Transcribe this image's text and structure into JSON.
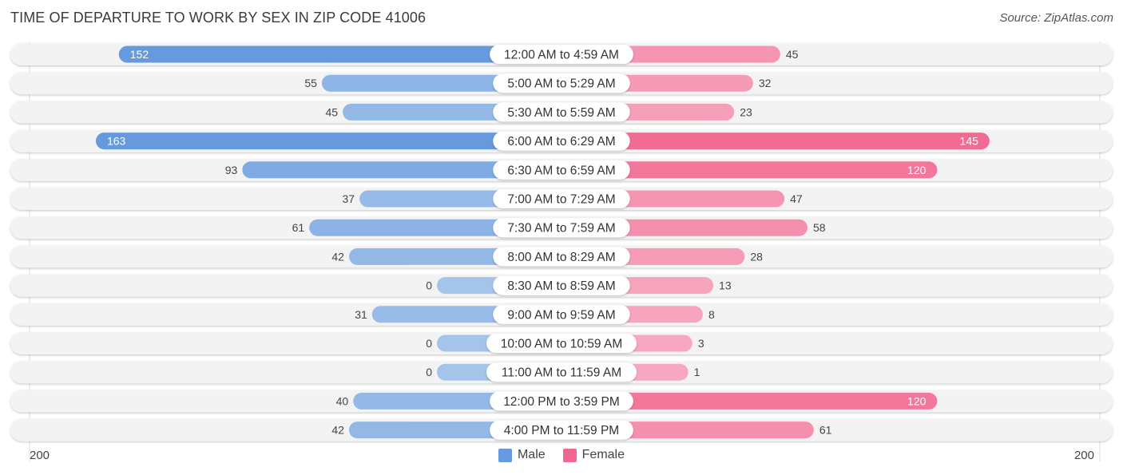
{
  "header": {
    "title": "TIME OF DEPARTURE TO WORK BY SEX IN ZIP CODE 41006",
    "source": "Source: ZipAtlas.com"
  },
  "colors": {
    "male_strong": "#6699dd",
    "male_light": "#a4c4ea",
    "female_strong": "#f06890",
    "female_light": "#f7a8c0",
    "row_bg": "#f3f3f3"
  },
  "legend": {
    "male_label": "Male",
    "female_label": "Female"
  },
  "axis": {
    "left_label": "200",
    "right_label": "200"
  },
  "chart_data": {
    "type": "bar",
    "orientation": "horizontal-diverging",
    "title": "TIME OF DEPARTURE TO WORK BY SEX IN ZIP CODE 41006",
    "categories": [
      "12:00 AM to 4:59 AM",
      "5:00 AM to 5:29 AM",
      "5:30 AM to 5:59 AM",
      "6:00 AM to 6:29 AM",
      "6:30 AM to 6:59 AM",
      "7:00 AM to 7:29 AM",
      "7:30 AM to 7:59 AM",
      "8:00 AM to 8:29 AM",
      "8:30 AM to 8:59 AM",
      "9:00 AM to 9:59 AM",
      "10:00 AM to 10:59 AM",
      "11:00 AM to 11:59 AM",
      "12:00 PM to 3:59 PM",
      "4:00 PM to 11:59 PM"
    ],
    "series": [
      {
        "name": "Male",
        "values": [
          152,
          55,
          45,
          163,
          93,
          37,
          61,
          42,
          0,
          31,
          0,
          0,
          40,
          42
        ]
      },
      {
        "name": "Female",
        "values": [
          45,
          32,
          23,
          145,
          120,
          47,
          58,
          28,
          13,
          8,
          3,
          1,
          120,
          61
        ]
      }
    ],
    "xlim": [
      -200,
      200
    ],
    "xtick_labels": [
      "200",
      "200"
    ],
    "legend_position": "bottom-center",
    "grid": false
  }
}
